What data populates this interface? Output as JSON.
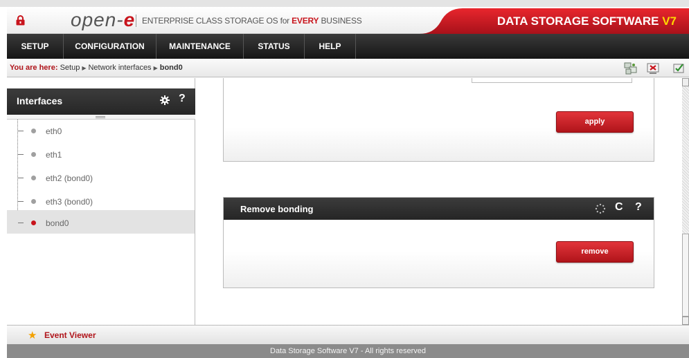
{
  "header": {
    "logo_text": "open-",
    "logo_e": "e",
    "tagline_prefix": "ENTERPRISE CLASS STORAGE OS for ",
    "tagline_em": "EVERY",
    "tagline_suffix": " BUSINESS",
    "brand_text": "DATA STORAGE SOFTWARE ",
    "brand_version": "V7",
    "brand_color": "#c8141c"
  },
  "nav": {
    "items": [
      {
        "label": "SETUP"
      },
      {
        "label": "CONFIGURATION"
      },
      {
        "label": "MAINTENANCE"
      },
      {
        "label": "STATUS"
      },
      {
        "label": "HELP"
      }
    ]
  },
  "breadcrumb": {
    "prefix": "You are here:",
    "items": [
      "Setup",
      "Network interfaces",
      "bond0"
    ]
  },
  "toolbar": {
    "icons": [
      "network-icon",
      "logout-icon",
      "update-icon"
    ]
  },
  "sidebar": {
    "title": "Interfaces",
    "help": "?",
    "items": [
      {
        "label": "eth0",
        "selected": false
      },
      {
        "label": "eth1",
        "selected": false
      },
      {
        "label": "eth2 (bond0)",
        "selected": false
      },
      {
        "label": "eth3 (bond0)",
        "selected": false
      },
      {
        "label": "bond0",
        "selected": true
      }
    ]
  },
  "main": {
    "apply_label": "apply",
    "remove_section": {
      "title": "Remove bonding",
      "refresh": "C",
      "help": "?",
      "remove_label": "remove"
    }
  },
  "event_viewer": {
    "label": "Event Viewer"
  },
  "footer": {
    "text": "Data Storage Software V7 - All rights reserved"
  }
}
